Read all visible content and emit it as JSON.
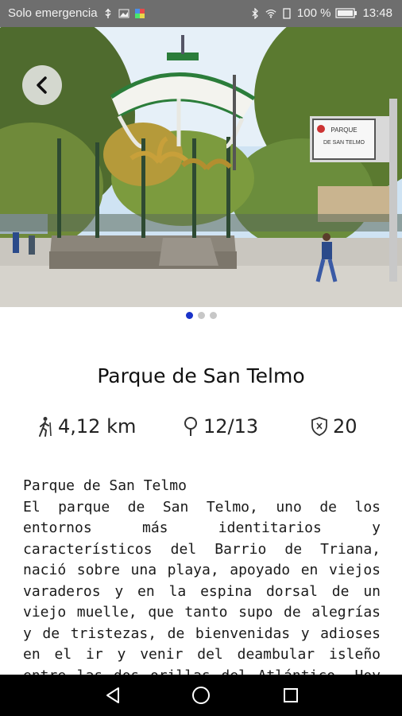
{
  "status_bar": {
    "carrier": "Solo emergencia",
    "battery": "100 %",
    "time": "13:48"
  },
  "gallery": {
    "sign_line1": "PARQUE",
    "sign_line2": "DE SAN TELMO",
    "dots": [
      true,
      false,
      false
    ]
  },
  "place": {
    "title": "Parque de San Telmo",
    "distance": "4,12 km",
    "points": "12/13",
    "score": "20"
  },
  "description": {
    "subtitle": "Parque de San Telmo",
    "body": "El parque de San Telmo, uno de los entornos más identitarios y característicos del Barrio de Triana, nació sobre una playa, apoyado en viejos varaderos y en la espina dorsal de un viejo muelle, que tanto supo de alegrías y de tristezas, de bienvenidas y adioses en el ir y venir del deambular isleño entre las dos orillas del Atlántico. Hoy el mar se ha alejado, el muelle ya no"
  },
  "colors": {
    "accent": "#1a33c9",
    "status_bar": "#6e6e6e"
  }
}
